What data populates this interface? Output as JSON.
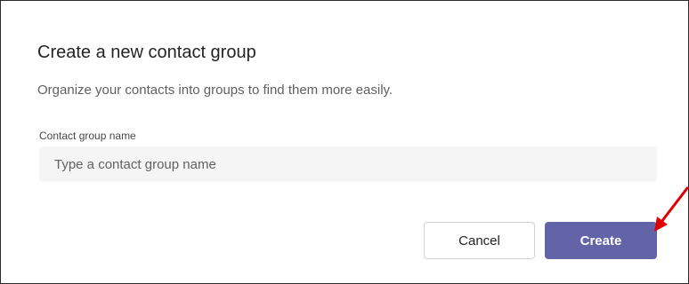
{
  "dialog": {
    "title": "Create a new contact group",
    "subtitle": "Organize your contacts into groups to find them more easily.",
    "field": {
      "label": "Contact group name",
      "placeholder": "Type a contact group name",
      "value": ""
    },
    "buttons": {
      "cancel": "Cancel",
      "create": "Create"
    }
  },
  "colors": {
    "primary": "#6264a7",
    "annotation": "#e00000"
  },
  "icons": {
    "annotation": "red-arrow-icon"
  }
}
